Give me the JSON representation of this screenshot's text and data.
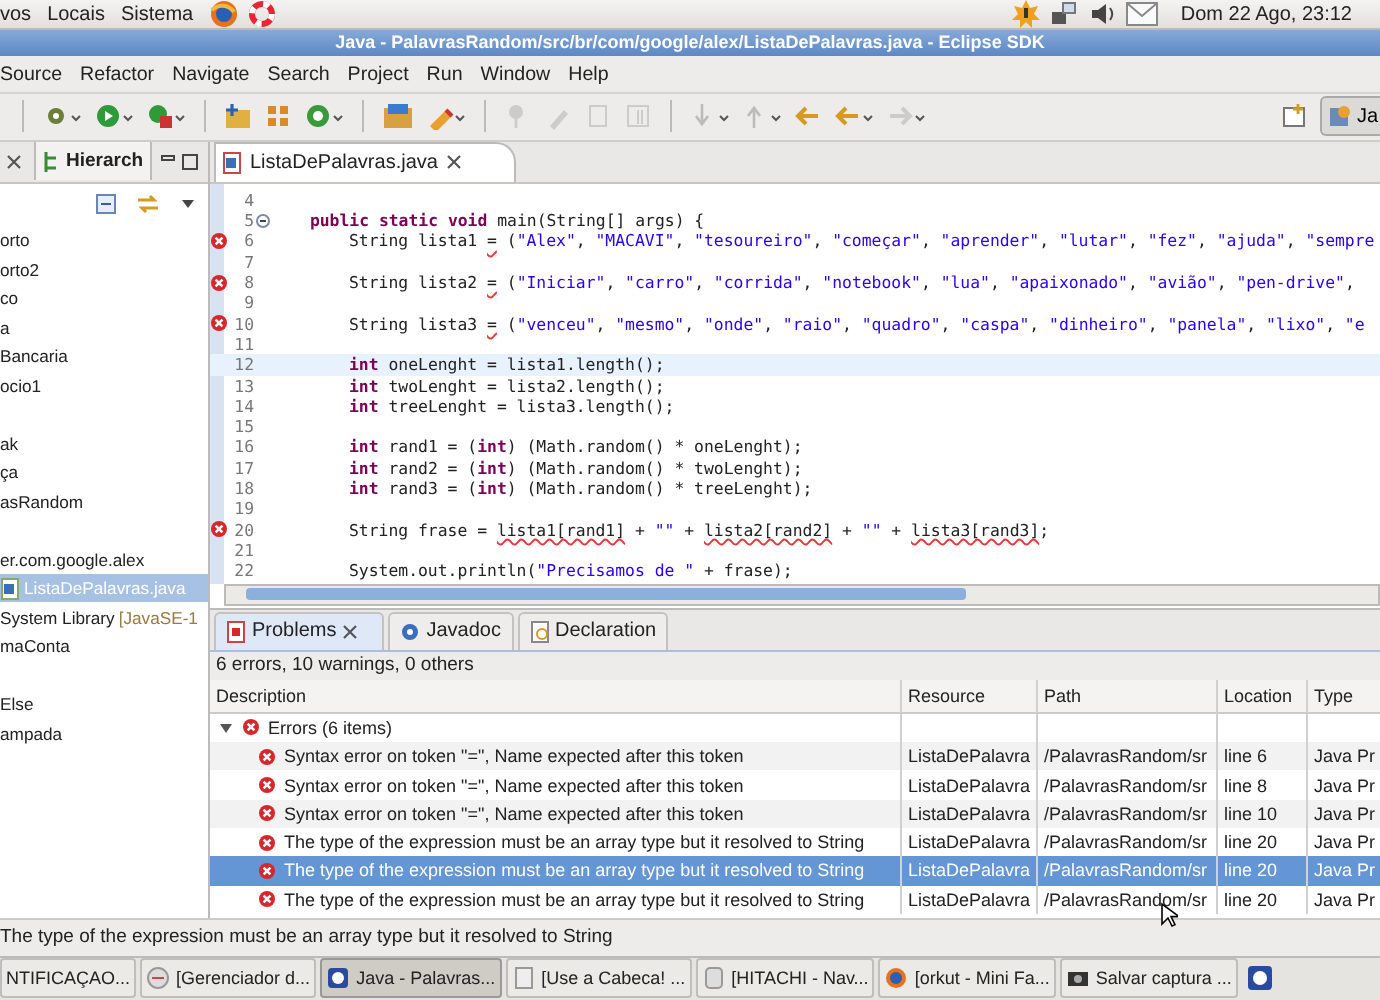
{
  "top_panel": {
    "menus": [
      "vos",
      "Locais",
      "Sistema"
    ],
    "clock": "Dom 22 Ago, 23:12"
  },
  "window": {
    "title": "Java - PalavrasRandom/src/br/com/google/alex/ListaDePalavras.java - Eclipse SDK"
  },
  "menu": [
    "Source",
    "Refactor",
    "Navigate",
    "Search",
    "Project",
    "Run",
    "Window",
    "Help"
  ],
  "toolbar": {
    "perspective": "Ja"
  },
  "explorer": {
    "tab": "Hierarch",
    "groups": [
      {
        "items": [
          {
            "label": "orto",
            "selected": false
          },
          {
            "label": "orto2",
            "selected": false
          },
          {
            "label": "co",
            "selected": false
          },
          {
            "label": "a",
            "selected": false
          },
          {
            "label": "Bancaria",
            "selected": false
          },
          {
            "label": "ocio1",
            "selected": false
          }
        ]
      },
      {
        "items": [
          {
            "label": "ak",
            "selected": false
          },
          {
            "label": "ça",
            "selected": false
          },
          {
            "label": "asRandom",
            "selected": false
          }
        ]
      },
      {
        "items": [
          {
            "label": "er.com.google.alex",
            "selected": false
          },
          {
            "label": "ListaDePalavras.java",
            "selected": true,
            "kind": "file"
          },
          {
            "label": "System Library",
            "suffix": "[JavaSE-1",
            "selected": false
          },
          {
            "label": "maConta",
            "selected": false
          }
        ]
      },
      {
        "items": [
          {
            "label": "Else",
            "selected": false
          },
          {
            "label": "ampada",
            "selected": false
          }
        ]
      }
    ]
  },
  "editor": {
    "tab": "ListaDePalavras.java",
    "lines": [
      {
        "number": "4",
        "error": false,
        "current": false,
        "fold": false
      },
      {
        "number": "5",
        "error": false,
        "current": false,
        "fold": true,
        "kind": "method",
        "segments": [
          {
            "kind": "keyword",
            "text": "public static void"
          },
          {
            "kind": "plain",
            "text": " main(String[] args) {"
          }
        ]
      },
      {
        "number": "6",
        "error": true,
        "current": false,
        "fold": false,
        "kind": "statement",
        "segments": [
          {
            "kind": "plain",
            "text": "String lista1 "
          },
          {
            "kind": "error",
            "text": "="
          },
          {
            "kind": "plain",
            "text": " (\"Alex\", \"MACAVI\", \"tesoureiro\", \"começar\", \"aprender\", \"lutar\", \"fez\", \"ajuda\", \"sempre"
          }
        ]
      },
      {
        "number": "7",
        "error": false,
        "current": false,
        "fold": false
      },
      {
        "number": "8",
        "error": true,
        "current": false,
        "fold": false,
        "kind": "statement",
        "segments": [
          {
            "kind": "plain",
            "text": "String lista2 "
          },
          {
            "kind": "error",
            "text": "="
          },
          {
            "kind": "plain",
            "text": " (\"Iniciar\", \"carro\", \"corrida\", \"notebook\", \"lua\", \"apaixonado\", \"avião\", \"pen-drive\","
          }
        ]
      },
      {
        "number": "9",
        "error": false,
        "current": false,
        "fold": false
      },
      {
        "number": "10",
        "error": true,
        "current": false,
        "fold": false,
        "kind": "statement",
        "segments": [
          {
            "kind": "plain",
            "text": "String lista3 "
          },
          {
            "kind": "error",
            "text": "="
          },
          {
            "kind": "plain",
            "text": " (\"venceu\", \"mesmo\", \"onde\", \"raio\", \"quadro\", \"caspa\", \"dinheiro\", \"panela\", \"lixo\", \"e"
          }
        ]
      },
      {
        "number": "11",
        "error": false,
        "current": false,
        "fold": false
      },
      {
        "number": "12",
        "error": false,
        "current": true,
        "fold": false,
        "kind": "statement",
        "segments": [
          {
            "kind": "keyword",
            "text": "int"
          },
          {
            "kind": "plain",
            "text": " oneLenght = lista1.length();"
          }
        ]
      },
      {
        "number": "13",
        "error": false,
        "current": false,
        "fold": false,
        "kind": "statement",
        "segments": [
          {
            "kind": "keyword",
            "text": "int"
          },
          {
            "kind": "plain",
            "text": " twoLenght = lista2.length();"
          }
        ]
      },
      {
        "number": "14",
        "error": false,
        "current": false,
        "fold": false,
        "kind": "statement",
        "segments": [
          {
            "kind": "keyword",
            "text": "int"
          },
          {
            "kind": "plain",
            "text": " treeLenght = lista3.length();"
          }
        ]
      },
      {
        "number": "15",
        "error": false,
        "current": false,
        "fold": false
      },
      {
        "number": "16",
        "error": false,
        "current": false,
        "fold": false,
        "kind": "statement",
        "segments": [
          {
            "kind": "keyword",
            "text": "int"
          },
          {
            "kind": "plain",
            "text": " rand1 = ("
          },
          {
            "kind": "keyword",
            "text": "int"
          },
          {
            "kind": "plain",
            "text": ") (Math.random() * oneLenght);"
          }
        ]
      },
      {
        "number": "17",
        "error": false,
        "current": false,
        "fold": false,
        "kind": "statement",
        "segments": [
          {
            "kind": "keyword",
            "text": "int"
          },
          {
            "kind": "plain",
            "text": " rand2 = ("
          },
          {
            "kind": "keyword",
            "text": "int"
          },
          {
            "kind": "plain",
            "text": ") (Math.random() * twoLenght);"
          }
        ]
      },
      {
        "number": "18",
        "error": false,
        "current": false,
        "fold": false,
        "kind": "statement",
        "segments": [
          {
            "kind": "keyword",
            "text": "int"
          },
          {
            "kind": "plain",
            "text": " rand3 = ("
          },
          {
            "kind": "keyword",
            "text": "int"
          },
          {
            "kind": "plain",
            "text": ") (Math.random() * treeLenght);"
          }
        ]
      },
      {
        "number": "19",
        "error": false,
        "current": false,
        "fold": false
      },
      {
        "number": "20",
        "error": true,
        "current": false,
        "fold": false,
        "kind": "statement",
        "segments": [
          {
            "kind": "plain",
            "text": "String frase = "
          },
          {
            "kind": "error",
            "text": "lista1[rand1]"
          },
          {
            "kind": "plain",
            "text": " + \"\" + "
          },
          {
            "kind": "error",
            "text": "lista2[rand2]"
          },
          {
            "kind": "plain",
            "text": " + \"\" + "
          },
          {
            "kind": "error",
            "text": "lista3[rand3]"
          },
          {
            "kind": "plain",
            "text": ";"
          }
        ]
      },
      {
        "number": "21",
        "error": false,
        "current": false,
        "fold": false
      },
      {
        "number": "22",
        "error": false,
        "current": false,
        "fold": false,
        "kind": "statement",
        "segments": [
          {
            "kind": "plain",
            "text": "System.out.println(\"Precisamos de \" + frase);"
          }
        ]
      }
    ]
  },
  "problems": {
    "tabs": [
      {
        "label": "Problems",
        "selected": true
      },
      {
        "label": "Javadoc",
        "selected": false
      },
      {
        "label": "Declaration",
        "selected": false
      }
    ],
    "summary": "6 errors, 10 warnings, 0 others",
    "columns": [
      "Description",
      "Resource",
      "Path",
      "Location",
      "Type"
    ],
    "group": {
      "label": "Errors (6 items)",
      "expanded": true
    },
    "rows": [
      {
        "description": "Syntax error on token \"=\", Name expected after this token",
        "resource": "ListaDePalavra",
        "path": "/PalavrasRandom/sr",
        "location": "line 6",
        "type": "Java Pr",
        "selected": false
      },
      {
        "description": "Syntax error on token \"=\", Name expected after this token",
        "resource": "ListaDePalavra",
        "path": "/PalavrasRandom/sr",
        "location": "line 8",
        "type": "Java Pr",
        "selected": false
      },
      {
        "description": "Syntax error on token \"=\", Name expected after this token",
        "resource": "ListaDePalavra",
        "path": "/PalavrasRandom/sr",
        "location": "line 10",
        "type": "Java Pr",
        "selected": false
      },
      {
        "description": "The type of the expression must be an array type but it resolved to String",
        "resource": "ListaDePalavra",
        "path": "/PalavrasRandom/sr",
        "location": "line 20",
        "type": "Java Pr",
        "selected": false
      },
      {
        "description": "The type of the expression must be an array type but it resolved to String",
        "resource": "ListaDePalavra",
        "path": "/PalavrasRandom/sr",
        "location": "line 20",
        "type": "Java Pr",
        "selected": true
      },
      {
        "description": "The type of the expression must be an array type but it resolved to String",
        "resource": "ListaDePalavra",
        "path": "/PalavrasRandom/sr",
        "location": "line 20",
        "type": "Java Pr",
        "selected": false
      }
    ]
  },
  "status_bar": "The type of the expression must be an array type but it resolved to String",
  "taskbar": [
    {
      "label": "NTIFICAÇAO...",
      "selected": false,
      "icon": false
    },
    {
      "label": "[Gerenciador d...",
      "selected": false,
      "icon": true
    },
    {
      "label": "Java - Palavras...",
      "selected": true,
      "icon": true
    },
    {
      "label": "[Use a Cabeca! ...",
      "selected": false,
      "icon": true
    },
    {
      "label": "[HITACHI - Nav...",
      "selected": false,
      "icon": true
    },
    {
      "label": "[orkut - Mini Fa...",
      "selected": false,
      "icon": true
    },
    {
      "label": "Salvar captura ...",
      "selected": false,
      "icon": true
    }
  ]
}
